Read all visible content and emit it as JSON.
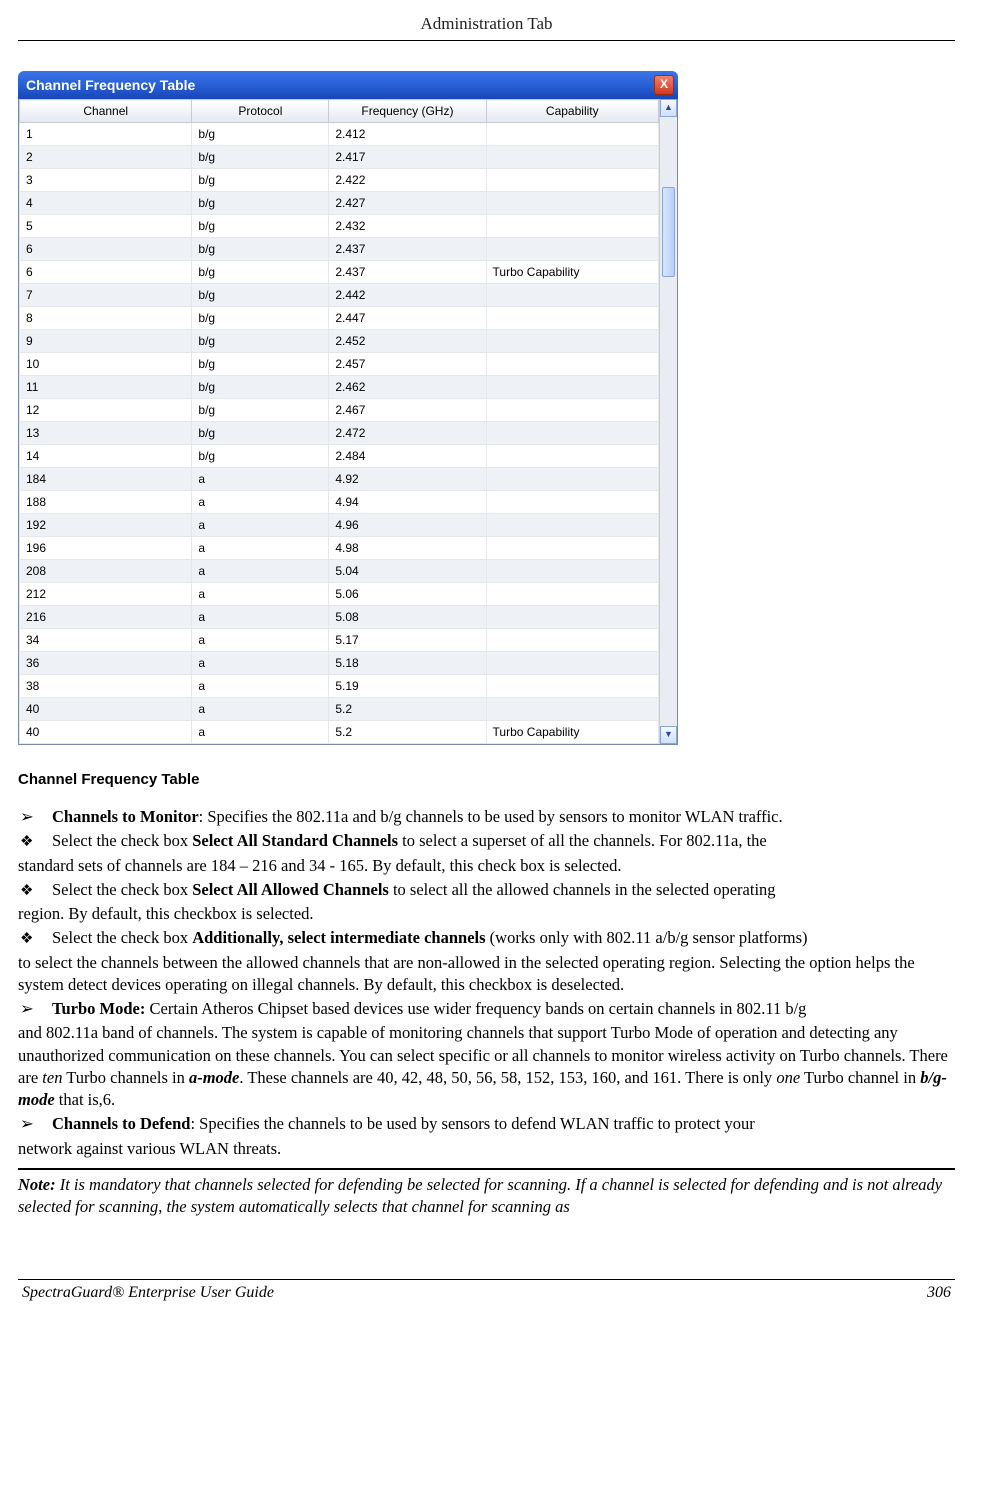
{
  "header": {
    "title": "Administration Tab"
  },
  "window": {
    "title": "Channel Frequency Table",
    "close_glyph": "X",
    "columns": {
      "channel": "Channel",
      "protocol": "Protocol",
      "frequency": "Frequency (GHz)",
      "capability": "Capability"
    },
    "rows": [
      {
        "ch": "1",
        "proto": "b/g",
        "freq": "2.412",
        "cap": ""
      },
      {
        "ch": "2",
        "proto": "b/g",
        "freq": "2.417",
        "cap": ""
      },
      {
        "ch": "3",
        "proto": "b/g",
        "freq": "2.422",
        "cap": ""
      },
      {
        "ch": "4",
        "proto": "b/g",
        "freq": "2.427",
        "cap": ""
      },
      {
        "ch": "5",
        "proto": "b/g",
        "freq": "2.432",
        "cap": ""
      },
      {
        "ch": "6",
        "proto": "b/g",
        "freq": "2.437",
        "cap": ""
      },
      {
        "ch": "6",
        "proto": "b/g",
        "freq": "2.437",
        "cap": "Turbo Capability"
      },
      {
        "ch": "7",
        "proto": "b/g",
        "freq": "2.442",
        "cap": ""
      },
      {
        "ch": "8",
        "proto": "b/g",
        "freq": "2.447",
        "cap": ""
      },
      {
        "ch": "9",
        "proto": "b/g",
        "freq": "2.452",
        "cap": ""
      },
      {
        "ch": "10",
        "proto": "b/g",
        "freq": "2.457",
        "cap": ""
      },
      {
        "ch": "11",
        "proto": "b/g",
        "freq": "2.462",
        "cap": ""
      },
      {
        "ch": "12",
        "proto": "b/g",
        "freq": "2.467",
        "cap": ""
      },
      {
        "ch": "13",
        "proto": "b/g",
        "freq": "2.472",
        "cap": ""
      },
      {
        "ch": "14",
        "proto": "b/g",
        "freq": "2.484",
        "cap": ""
      },
      {
        "ch": "184",
        "proto": "a",
        "freq": "4.92",
        "cap": ""
      },
      {
        "ch": "188",
        "proto": "a",
        "freq": "4.94",
        "cap": ""
      },
      {
        "ch": "192",
        "proto": "a",
        "freq": "4.96",
        "cap": ""
      },
      {
        "ch": "196",
        "proto": "a",
        "freq": "4.98",
        "cap": ""
      },
      {
        "ch": "208",
        "proto": "a",
        "freq": "5.04",
        "cap": ""
      },
      {
        "ch": "212",
        "proto": "a",
        "freq": "5.06",
        "cap": ""
      },
      {
        "ch": "216",
        "proto": "a",
        "freq": "5.08",
        "cap": ""
      },
      {
        "ch": "34",
        "proto": "a",
        "freq": "5.17",
        "cap": ""
      },
      {
        "ch": "36",
        "proto": "a",
        "freq": "5.18",
        "cap": ""
      },
      {
        "ch": "38",
        "proto": "a",
        "freq": "5.19",
        "cap": ""
      },
      {
        "ch": "40",
        "proto": "a",
        "freq": "5.2",
        "cap": ""
      },
      {
        "ch": "40",
        "proto": "a",
        "freq": "5.2",
        "cap": "Turbo Capability"
      }
    ]
  },
  "section_title": "Channel Frequency Table",
  "bullets": {
    "b1_lead": "Channels to Monitor",
    "b1_rest": ": Specifies the 802.11a and b/g channels to be used by sensors to monitor WLAN traffic.",
    "b2_pre": "Select the check box ",
    "b2_bold": "Select All Standard Channels",
    "b2_post": " to select a superset of all the channels. For 802.11a, the",
    "b2_cont": "standard sets of channels are 184 – 216 and 34 - 165. By default, this check box is selected.",
    "b3_pre": "Select the check box ",
    "b3_bold": "Select All Allowed Channels",
    "b3_post": " to select all the allowed channels in the selected operating",
    "b3_cont": "region. By default, this checkbox is selected.",
    "b4_pre": "Select the check box ",
    "b4_bold": "Additionally, select intermediate channels",
    "b4_post": " (works only with 802.11 a/b/g sensor platforms)",
    "b4_cont": "to select the channels between the allowed channels that are non-allowed in the selected operating region. Selecting the option helps the system detect devices operating on illegal channels. By default, this checkbox is deselected.",
    "b5_lead": "Turbo Mode:",
    "b5_rest": " Certain Atheros Chipset based devices use wider frequency bands on certain channels in 802.11 b/g",
    "b5_cont1": "and 802.11a band of channels. The system is capable of monitoring channels that support Turbo Mode of operation and detecting any unauthorized communication on these channels. You can select specific or all channels to monitor wireless activity on Turbo channels. There are ",
    "b5_it1": "ten",
    "b5_mid1": " Turbo channels in ",
    "b5_bi1": "a-mode",
    "b5_mid2": ". These channels are 40, 42, 48, 50, 56, 58, 152, 153, 160, and 161. There is only ",
    "b5_it2": "one",
    "b5_mid3": " Turbo channel in ",
    "b5_bi2": "b/g-mode",
    "b5_end": " that is,6.",
    "b6_lead": "Channels to Defend",
    "b6_rest": ": Specifies the channels to be used by sensors to defend WLAN traffic to protect your",
    "b6_cont": "network against various WLAN threats."
  },
  "note": {
    "label": "Note:",
    "text": " It is mandatory that channels selected for defending be selected for scanning. If a channel is selected for defending and is not already selected for scanning, the system automatically selects that channel for scanning as"
  },
  "footer": {
    "left": "SpectraGuard®  Enterprise User Guide",
    "right": "306"
  },
  "glyphs": {
    "arrow": "➢",
    "diamond": "❖"
  }
}
